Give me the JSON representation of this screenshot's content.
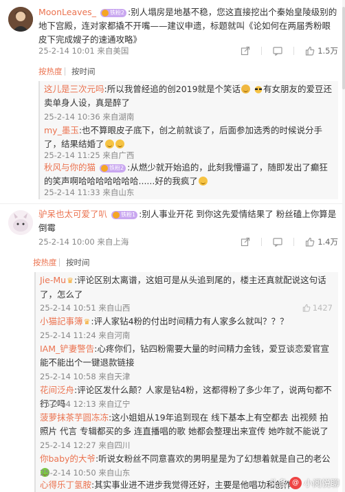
{
  "comment1": {
    "username": "MoonLeaves_",
    "badge": "铁粉2",
    "text": "别人塌房是地基不稳，您这直接挖出个秦始皇陵级别的地下宫殿，连对家都撬不开嘴——建议申遗，标题就叫《论如何在两届秀粉眼皮下完成嫂子的速通攻略》",
    "timestamp": "25-2-14 10:01",
    "source": "来自美国",
    "like_count": "1.5万"
  },
  "sort1": {
    "hot": "按热度",
    "time": "按时间"
  },
  "replies1": [
    {
      "user": "这儿是三次元吗",
      "text": "所以我曾经追的创2019就是个笑话",
      "text2": "有女朋友的爱豆还卖单身人设，真是醉了",
      "timestamp": "25-2-14 10:36",
      "source": "来自湖南"
    },
    {
      "user": "my_墨玉",
      "text": "也不算眼皮子底下，创之前就谈了，后面参加选秀的时候说分手了，结果结婚了",
      "timestamp": "25-2-14 11:25",
      "source": "来自广西"
    },
    {
      "user": "秋风与你的猫",
      "badge": "铁粉2",
      "text": "从燃少就开始追的，此刻我懵逼了，随即发出了癫狂的笑声啊哈哈哈哈哈哈哈......好的我疯了",
      "timestamp": "25-2-14 11:33",
      "source": "来自山东"
    }
  ],
  "comment2": {
    "username": "驴呆也太可爱了叭",
    "badge": "铁粉1",
    "text": "别人事业开花 到你这先爱情结果了 粉丝磕上你算是倒霉",
    "timestamp": "25-2-14 10:00",
    "source": "来自上海",
    "like_count": "1.4万"
  },
  "sort2": {
    "hot": "按热度",
    "time": "按时间"
  },
  "replies2": [
    {
      "user": "Jie-Mu",
      "text": "评论区别太离谱，这姐可是从头追到尾的，楼主还真就配说这句话了，怎么了",
      "timestamp": "25-2-14 10:51",
      "source": "来自山西",
      "like_count": "1427"
    },
    {
      "user": "小猫記事簿",
      "text": "评人家钻4粉的付出时间精力有人家多么就叫？？？",
      "timestamp": "25-2-14 11:24",
      "source": "来自河南"
    },
    {
      "user": "IAM_铲妻警告",
      "text": "心疼你们，钻四粉需要大量的时间精力金钱，爱豆谈恋爱官宣能不能出个一键退款链接",
      "timestamp": "25-2-14 10:58",
      "source": "来自天津"
    },
    {
      "user": "花间泛舟",
      "text": "评论区发什么颠？人家是钻4粉，这都得粉了多少年了，说两句都不行了吗",
      "timestamp": "25-2-14 12:13",
      "source": "来自辽宁"
    },
    {
      "user": "菠萝抹茶芋圆冻冻",
      "text": "这小姐姐从19年追到现在 线下基本上有空都去 出视频 拍照片 代言 专辑都买的多 连直播唱的歌 她都会整理出来宣传 她咋就不能说了",
      "timestamp": "25-2-14 12:27",
      "source": "来自四川"
    },
    {
      "user": "你baby的大爷",
      "text": "听说女粉丝不同意喜欢的男明星是为了幻想着就是自己的老公",
      "timestamp": "25-2-14 10:50",
      "source": "来自山东"
    },
    {
      "user": "心得乐丁氢胺",
      "text": "其实事业进不进步我觉得还好，主要是他唱功和创作都",
      "timestamp": "",
      "source": ""
    }
  ],
  "watermark": {
    "prefix": "头条",
    "logo": "@",
    "name": "小阅悦聊"
  },
  "colors": {
    "username": "#eb7350",
    "accent": "#eb7350",
    "meta": "#888888",
    "reply_bg": "#f7f7f7"
  }
}
